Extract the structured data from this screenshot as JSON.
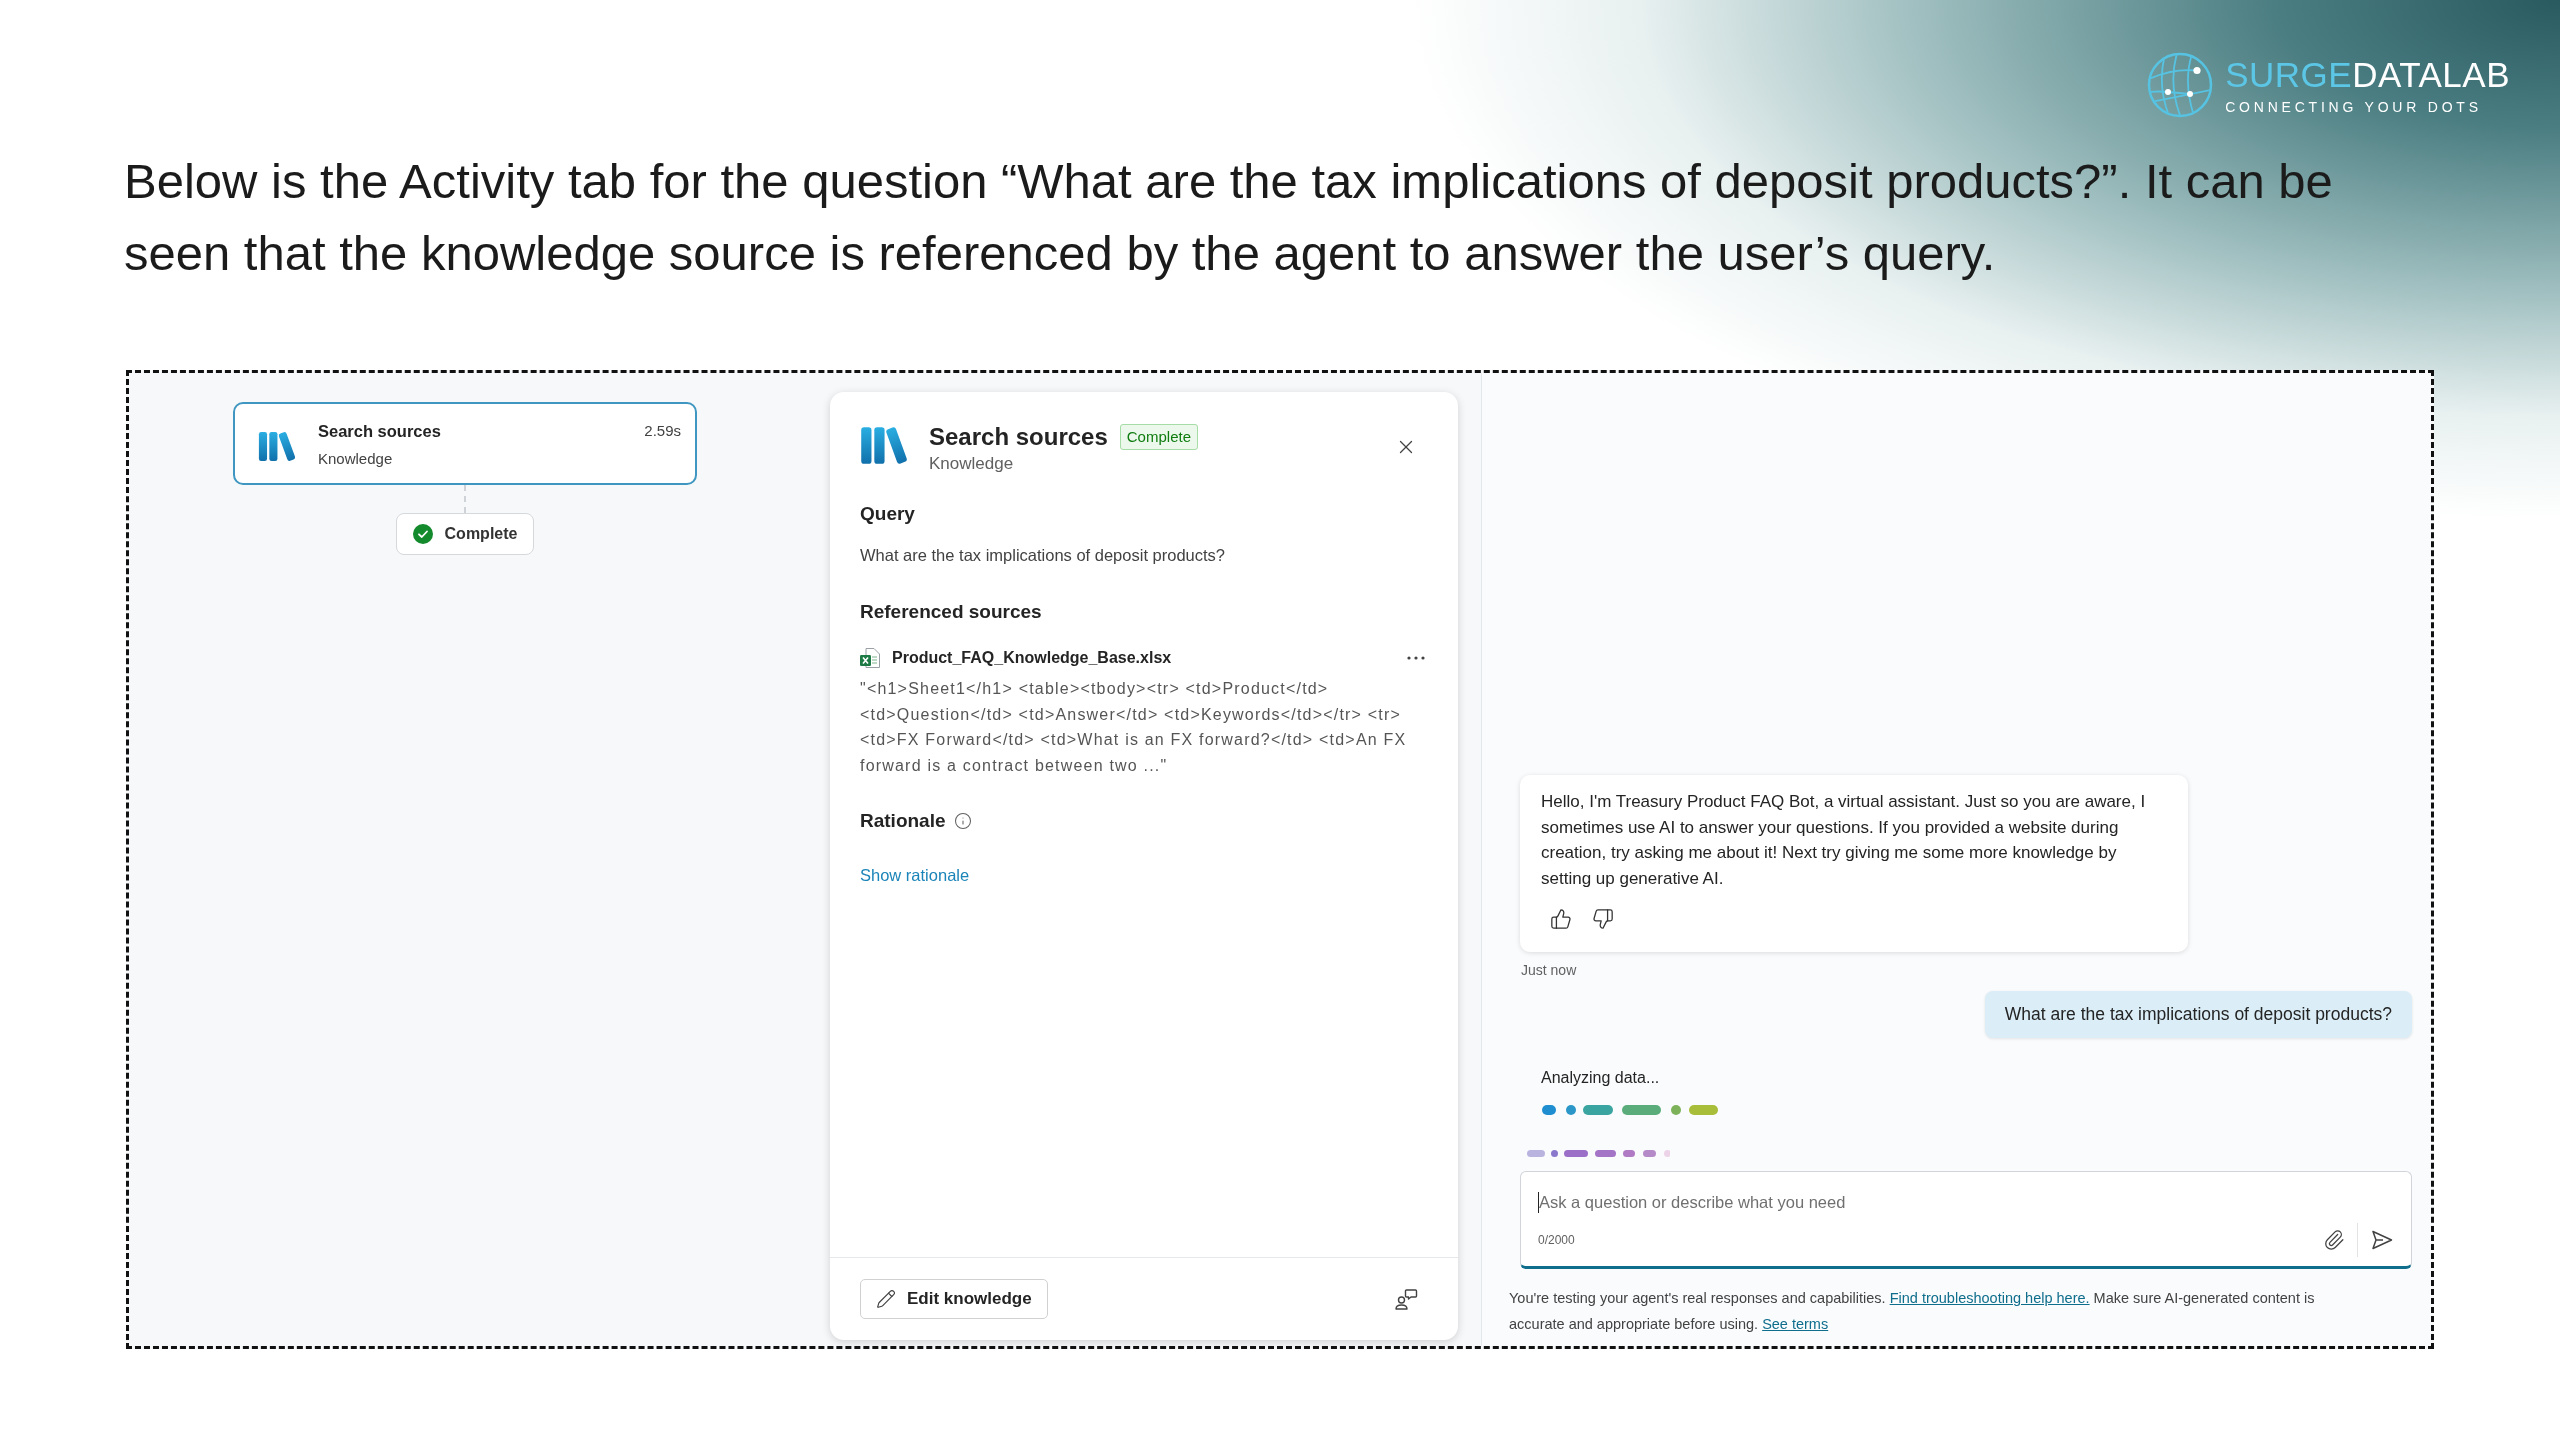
{
  "logo": {
    "brand_first": "SURGE",
    "brand_second": "DATALAB",
    "tagline": "CONNECTING YOUR DOTS"
  },
  "intro": "Below is the Activity tab for the question “What are the tax implications of deposit products?”. It can be seen that the knowledge source is referenced by the agent to answer the user’s query.",
  "activity_map": {
    "node": {
      "title": "Search sources",
      "subtitle": "Knowledge",
      "duration": "2.59s",
      "selected": true
    },
    "status": {
      "label": "Complete",
      "kind": "success"
    }
  },
  "details_panel": {
    "title": "Search sources",
    "status_badge": "Complete",
    "subtitle": "Knowledge",
    "query": {
      "heading": "Query",
      "text": "What are the tax implications of deposit products?"
    },
    "referenced_sources": {
      "heading": "Referenced sources",
      "items": [
        {
          "file_name": "Product_FAQ_Knowledge_Base.xlsx",
          "snippet": "\"<h1>Sheet1</h1> <table><tbody><tr> <td>Product</td> <td>Question</td> <td>Answer</td> <td>Keywords</td></tr> <tr> <td>FX Forward</td> <td>What is an FX forward?</td> <td>An FX forward is a contract between two ...\""
        }
      ]
    },
    "rationale": {
      "heading": "Rationale",
      "link": "Show rationale"
    },
    "footer_button": "Edit knowledge"
  },
  "chat": {
    "messages": [
      {
        "kind": "bot",
        "text": "Hello, I'm Treasury Product FAQ Bot, a virtual assistant. Just so you are aware, I sometimes use AI to answer your questions. If you provided a website during creation, try asking me about it! Next try giving me some more knowledge by setting up generative AI.",
        "timestamp": "Just now"
      },
      {
        "kind": "user",
        "text": "What are the tax implications of deposit products?"
      }
    ],
    "status_text": "Analyzing data...",
    "composer": {
      "placeholder": "Ask a question or describe what you need",
      "counter": "0/2000",
      "focused": true
    },
    "disclaimer": [
      {
        "kind": "text",
        "text": "You're testing your agent's real responses and capabilities."
      },
      {
        "kind": "link",
        "text": "Find troubleshooting help here."
      },
      {
        "kind": "text",
        "text": "Make sure AI-generated content is accurate and appropriate before using."
      },
      {
        "kind": "link",
        "text": "See terms"
      }
    ]
  }
}
